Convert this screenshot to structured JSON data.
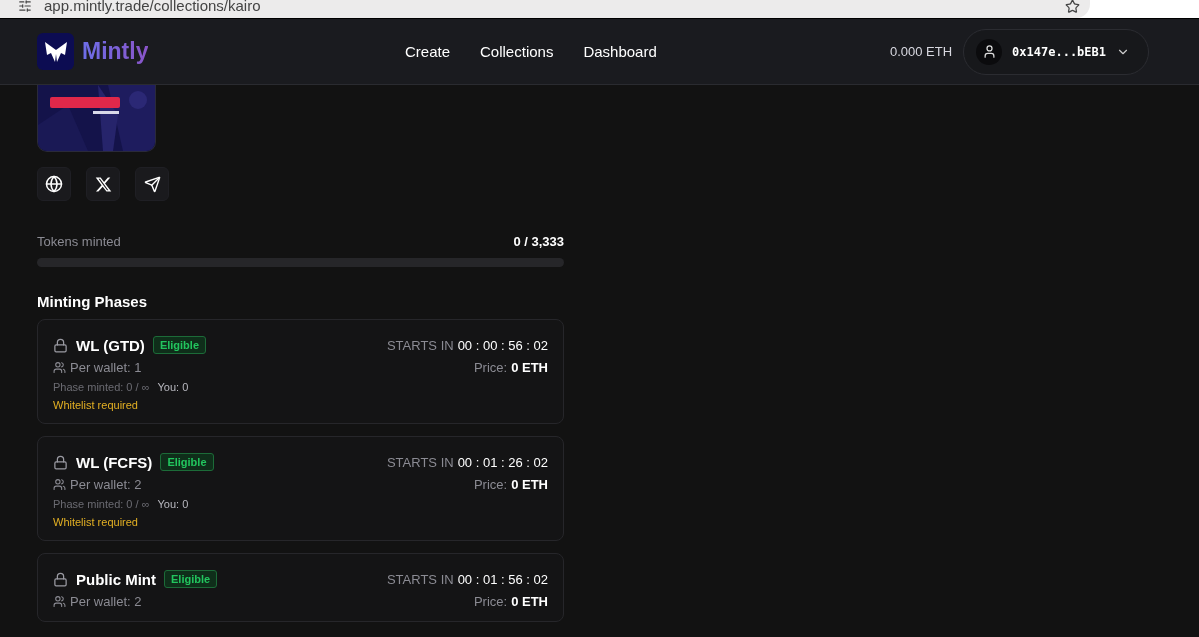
{
  "browser": {
    "url": "app.mintly.trade/collections/kairo"
  },
  "header": {
    "brand": "Mintly",
    "nav": [
      "Create",
      "Collections",
      "Dashboard"
    ],
    "balance": "0.000 ETH",
    "wallet": "0x147e...bEB1"
  },
  "collection": {
    "links": [
      {
        "kind": "globe"
      },
      {
        "kind": "x"
      },
      {
        "kind": "plane"
      }
    ]
  },
  "tokens": {
    "label": "Tokens minted",
    "value": "0 / 3,333",
    "level": 0
  },
  "phases_title": "Minting Phases",
  "phases": [
    {
      "name": "WL (GTD)",
      "locked": true,
      "eligible": true,
      "badge": "Eligible",
      "starts_label": "STARTS IN",
      "countdown": "00 : 00 : 56 : 02",
      "per_wallet": "Per wallet: 1",
      "price_label": "Price:",
      "price": "0 ETH",
      "phase_minted": "Phase minted: 0 / ∞",
      "you": "You: 0",
      "note": "Whitelist required"
    },
    {
      "name": "WL (FCFS)",
      "locked": true,
      "eligible": true,
      "badge": "Eligible",
      "starts_label": "STARTS IN",
      "countdown": "00 : 01 : 26 : 02",
      "per_wallet": "Per wallet: 2",
      "price_label": "Price:",
      "price": "0 ETH",
      "phase_minted": "Phase minted: 0 / ∞",
      "you": "You: 0",
      "note": "Whitelist required"
    },
    {
      "name": "Public Mint",
      "locked": true,
      "eligible": true,
      "badge": "Eligible",
      "starts_label": "STARTS IN",
      "countdown": "00 : 01 : 56 : 02",
      "per_wallet": "Per wallet: 2",
      "price_label": "Price:",
      "price": "0 ETH"
    }
  ]
}
